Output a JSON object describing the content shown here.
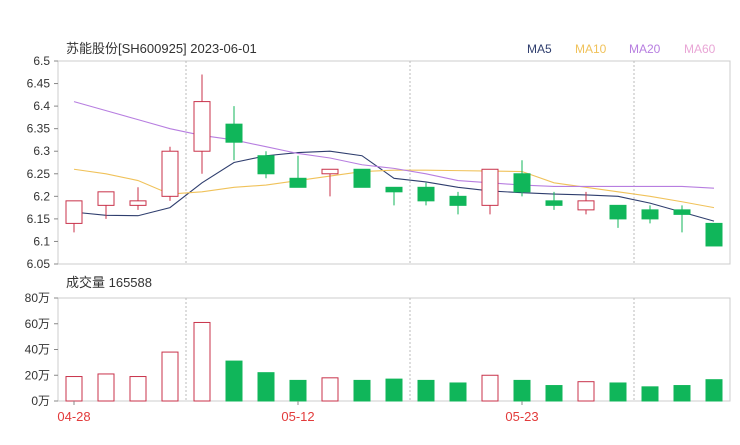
{
  "header": {
    "title": "苏能股份[SH600925] 2023-06-01",
    "legend": [
      {
        "label": "MA5",
        "color": "#2f3e6e"
      },
      {
        "label": "MA10",
        "color": "#f0c25a"
      },
      {
        "label": "MA20",
        "color": "#b77ee0"
      },
      {
        "label": "MA60",
        "color": "#e9a6d6"
      }
    ]
  },
  "volume_header": {
    "label": "成交量 165588"
  },
  "colors": {
    "up": "#c8324a",
    "down": "#10b65a",
    "grid": "#cccccc",
    "axis": "#555555",
    "date_label": "#e23b3b"
  },
  "chart_data": [
    {
      "type": "candlestick",
      "title": "苏能股份[SH600925] 2023-06-01",
      "ylim": [
        6.05,
        6.5
      ],
      "yticks": [
        "6.5",
        "6.45",
        "6.4",
        "6.35",
        "6.3",
        "6.25",
        "6.2",
        "6.15",
        "6.1",
        "6.05"
      ],
      "x_labels": [
        {
          "label": "04-28",
          "index": 0
        },
        {
          "label": "05-12",
          "index": 7
        },
        {
          "label": "05-23",
          "index": 14
        }
      ],
      "candles": [
        {
          "open": 6.14,
          "close": 6.19,
          "high": 6.19,
          "low": 6.12
        },
        {
          "open": 6.18,
          "close": 6.21,
          "high": 6.21,
          "low": 6.15
        },
        {
          "open": 6.18,
          "close": 6.19,
          "high": 6.22,
          "low": 6.17
        },
        {
          "open": 6.2,
          "close": 6.3,
          "high": 6.31,
          "low": 6.19
        },
        {
          "open": 6.3,
          "close": 6.41,
          "high": 6.47,
          "low": 6.25
        },
        {
          "open": 6.36,
          "close": 6.32,
          "high": 6.4,
          "low": 6.28
        },
        {
          "open": 6.29,
          "close": 6.25,
          "high": 6.3,
          "low": 6.24
        },
        {
          "open": 6.24,
          "close": 6.22,
          "high": 6.29,
          "low": 6.22
        },
        {
          "open": 6.25,
          "close": 6.26,
          "high": 6.26,
          "low": 6.2
        },
        {
          "open": 6.26,
          "close": 6.22,
          "high": 6.26,
          "low": 6.22
        },
        {
          "open": 6.22,
          "close": 6.21,
          "high": 6.22,
          "low": 6.18
        },
        {
          "open": 6.22,
          "close": 6.19,
          "high": 6.23,
          "low": 6.18
        },
        {
          "open": 6.2,
          "close": 6.18,
          "high": 6.21,
          "low": 6.16
        },
        {
          "open": 6.18,
          "close": 6.26,
          "high": 6.26,
          "low": 6.16
        },
        {
          "open": 6.25,
          "close": 6.21,
          "high": 6.28,
          "low": 6.2
        },
        {
          "open": 6.19,
          "close": 6.18,
          "high": 6.21,
          "low": 6.17
        },
        {
          "open": 6.17,
          "close": 6.19,
          "high": 6.21,
          "low": 6.16
        },
        {
          "open": 6.18,
          "close": 6.15,
          "high": 6.18,
          "low": 6.13
        },
        {
          "open": 6.17,
          "close": 6.15,
          "high": 6.18,
          "low": 6.14
        },
        {
          "open": 6.17,
          "close": 6.16,
          "high": 6.18,
          "low": 6.12
        },
        {
          "open": 6.14,
          "close": 6.09,
          "high": 6.14,
          "low": 6.09
        }
      ],
      "series": [
        {
          "name": "MA5",
          "color": "#2f3e6e",
          "values": [
            6.165,
            6.158,
            6.157,
            6.175,
            6.23,
            6.275,
            6.29,
            6.297,
            6.3,
            6.29,
            6.24,
            6.232,
            6.22,
            6.212,
            6.208,
            6.205,
            6.203,
            6.2,
            6.185,
            6.165,
            6.145
          ]
        },
        {
          "name": "MA10",
          "color": "#f0c25a",
          "values": [
            6.26,
            6.25,
            6.235,
            6.205,
            6.21,
            6.22,
            6.225,
            6.235,
            6.245,
            6.255,
            6.258,
            6.258,
            6.257,
            6.256,
            6.255,
            6.23,
            6.22,
            6.21,
            6.2,
            6.188,
            6.175
          ]
        },
        {
          "name": "MA20",
          "color": "#b77ee0",
          "values": [
            6.41,
            6.39,
            6.37,
            6.35,
            6.335,
            6.325,
            6.31,
            6.295,
            6.285,
            6.27,
            6.262,
            6.25,
            6.235,
            6.23,
            6.225,
            6.222,
            6.222,
            6.222,
            6.222,
            6.222,
            6.218
          ]
        }
      ]
    },
    {
      "type": "bar",
      "title": "成交量 165588",
      "ylim": [
        0,
        80
      ],
      "yticks": [
        "80万",
        "60万",
        "40万",
        "20万",
        "0万"
      ],
      "values": [
        19,
        21,
        19,
        38,
        61,
        31,
        22,
        16,
        18,
        16,
        17,
        16,
        14,
        20,
        16,
        12,
        15,
        14,
        11,
        12,
        16.5558
      ]
    }
  ]
}
